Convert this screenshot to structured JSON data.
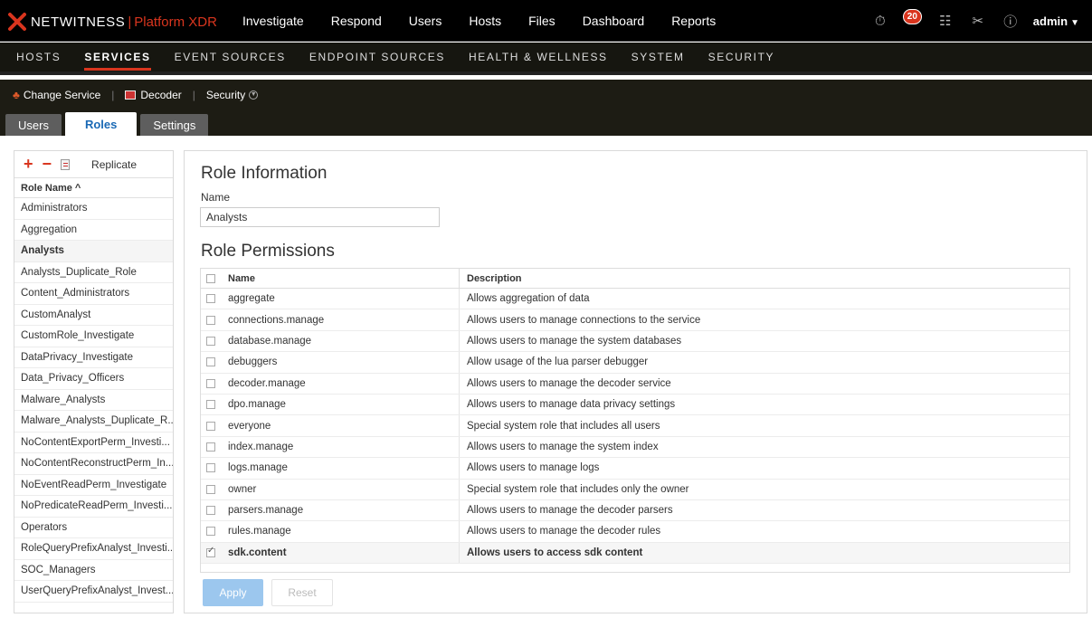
{
  "topbar": {
    "brand": "NETWITNESS",
    "product": "Platform XDR",
    "nav": [
      "Investigate",
      "Respond",
      "Users",
      "Hosts",
      "Files",
      "Dashboard",
      "Reports"
    ],
    "notification_count": "20",
    "user": "admin"
  },
  "subnav": {
    "items": [
      "HOSTS",
      "SERVICES",
      "EVENT SOURCES",
      "ENDPOINT SOURCES",
      "HEALTH & WELLNESS",
      "SYSTEM",
      "SECURITY"
    ],
    "active": "SERVICES"
  },
  "servicebar": {
    "change_service": "Change Service",
    "service": "Decoder",
    "section": "Security"
  },
  "tabs": [
    "Users",
    "Roles",
    "Settings"
  ],
  "active_tab": "Roles",
  "left_panel": {
    "replicate_label": "Replicate",
    "header": "Role Name ^",
    "roles": [
      "Administrators",
      "Aggregation",
      "Analysts",
      "Analysts_Duplicate_Role",
      "Content_Administrators",
      "CustomAnalyst",
      "CustomRole_Investigate",
      "DataPrivacy_Investigate",
      "Data_Privacy_Officers",
      "Malware_Analysts",
      "Malware_Analysts_Duplicate_R...",
      "NoContentExportPerm_Investi...",
      "NoContentReconstructPerm_In...",
      "NoEventReadPerm_Investigate",
      "NoPredicateReadPerm_Investi...",
      "Operators",
      "RoleQueryPrefixAnalyst_Investi...",
      "SOC_Managers",
      "UserQueryPrefixAnalyst_Invest..."
    ],
    "selected_role": "Analysts"
  },
  "main": {
    "info_title": "Role Information",
    "name_label": "Name",
    "name_value": "Analysts",
    "perm_title": "Role Permissions",
    "col_name": "Name",
    "col_desc": "Description",
    "permissions": [
      {
        "name": "aggregate",
        "desc": "Allows aggregation of data",
        "checked": false
      },
      {
        "name": "connections.manage",
        "desc": "Allows users to manage connections to the service",
        "checked": false
      },
      {
        "name": "database.manage",
        "desc": "Allows users to manage the system databases",
        "checked": false
      },
      {
        "name": "debuggers",
        "desc": "Allow usage of the lua parser debugger",
        "checked": false
      },
      {
        "name": "decoder.manage",
        "desc": "Allows users to manage the decoder service",
        "checked": false
      },
      {
        "name": "dpo.manage",
        "desc": "Allows users to manage data privacy settings",
        "checked": false
      },
      {
        "name": "everyone",
        "desc": "Special system role that includes all users",
        "checked": false
      },
      {
        "name": "index.manage",
        "desc": "Allows users to manage the system index",
        "checked": false
      },
      {
        "name": "logs.manage",
        "desc": "Allows users to manage logs",
        "checked": false
      },
      {
        "name": "owner",
        "desc": "Special system role that includes only the owner",
        "checked": false
      },
      {
        "name": "parsers.manage",
        "desc": "Allows users to manage the decoder parsers",
        "checked": false
      },
      {
        "name": "rules.manage",
        "desc": "Allows users to manage the decoder rules",
        "checked": false
      },
      {
        "name": "sdk.content",
        "desc": "Allows users to access sdk content",
        "checked": true
      }
    ],
    "apply_label": "Apply",
    "reset_label": "Reset"
  }
}
